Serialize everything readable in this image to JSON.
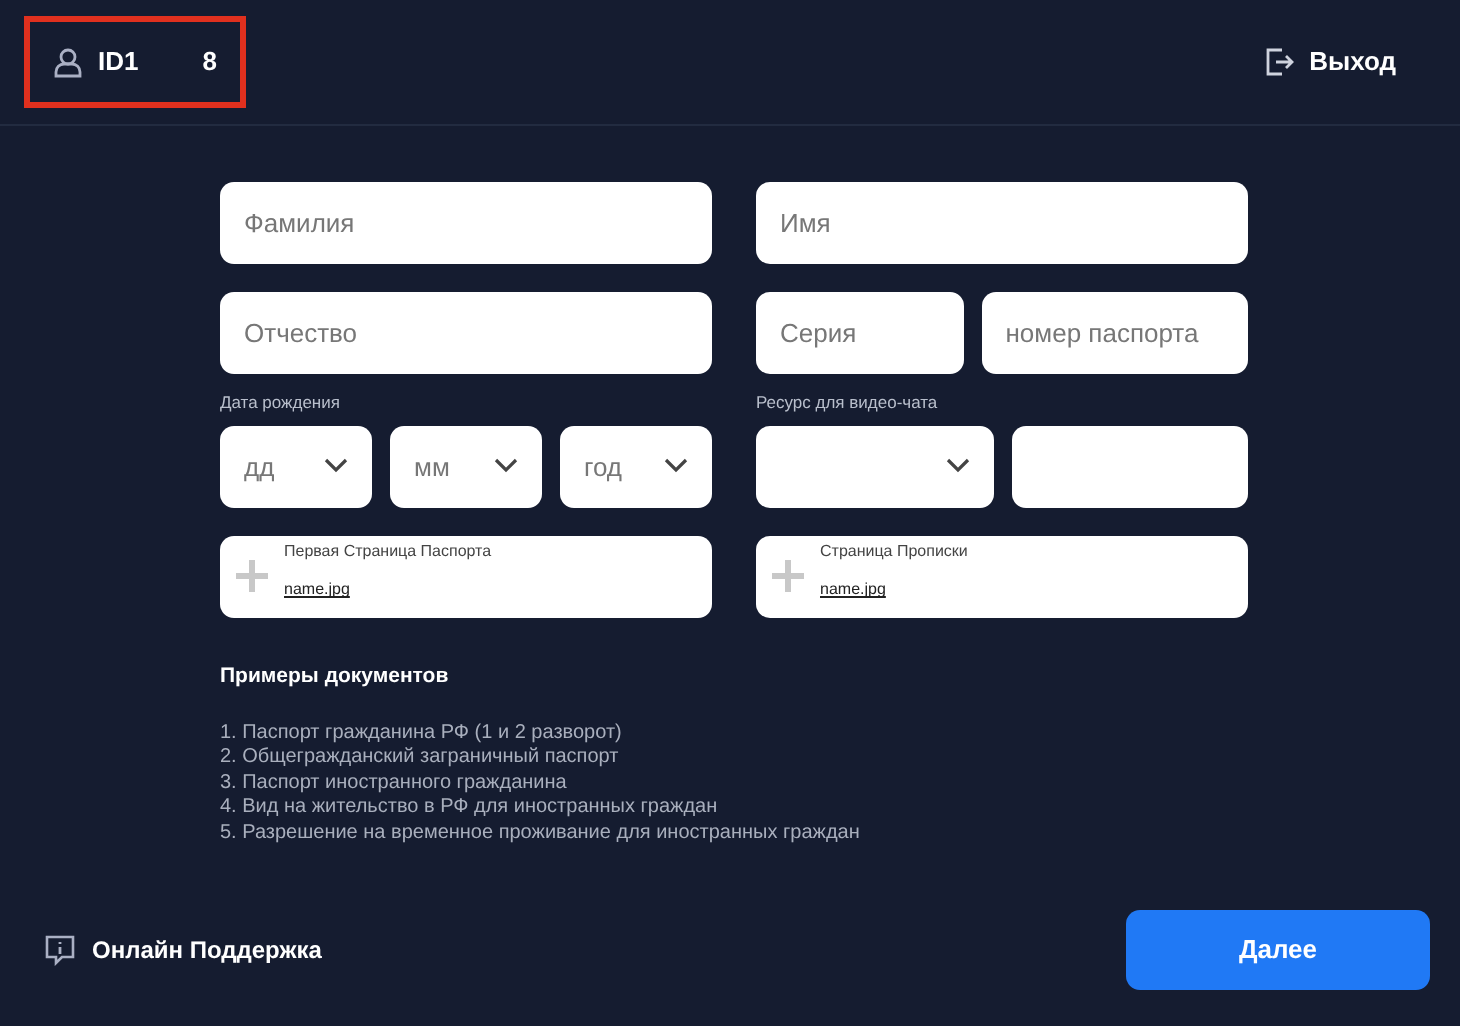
{
  "header": {
    "user": {
      "label": "ID1",
      "value": "8",
      "highlighted": true
    },
    "logout": "Выход"
  },
  "rows": [
    {
      "columns": [
        {
          "fields": [
            {
              "kind": "input",
              "placeholder": "Фамилия"
            }
          ]
        },
        {
          "fields": [
            {
              "kind": "input",
              "placeholder": "Имя"
            }
          ]
        }
      ]
    },
    {
      "columns": [
        {
          "fields": [
            {
              "kind": "input",
              "placeholder": "Отчество"
            }
          ]
        },
        {
          "fields": [
            {
              "kind": "input",
              "placeholder": "Серия"
            },
            {
              "kind": "input",
              "placeholder": "номер паспорта"
            }
          ]
        }
      ]
    },
    {
      "columns": [
        {
          "label": "Дата рождения",
          "fields": [
            {
              "kind": "select",
              "placeholder": "дд"
            },
            {
              "kind": "select",
              "placeholder": "мм"
            },
            {
              "kind": "select",
              "placeholder": "год"
            }
          ]
        },
        {
          "label": "Ресурс для видео-чата",
          "fields": [
            {
              "kind": "select"
            },
            {
              "kind": "input"
            }
          ]
        }
      ]
    }
  ],
  "uploads": [
    {
      "title": "Первая Страница Паспорта",
      "file": "name.jpg"
    },
    {
      "title": "Страница Прописки",
      "file": "name.jpg"
    }
  ],
  "examples": {
    "title": "Примеры документов",
    "items": [
      "1. Паспорт гражданина РФ (1 и 2 разворот)",
      "2. Общегражданский заграничный паспорт",
      "3. Паспорт иностранного гражданина",
      "4. Вид на жительство в РФ для иностранных граждан",
      "5. Разрешение на временное проживание для иностранных граждан"
    ]
  },
  "footer": {
    "support": "Онлайн Поддержка",
    "next": "Далее"
  }
}
